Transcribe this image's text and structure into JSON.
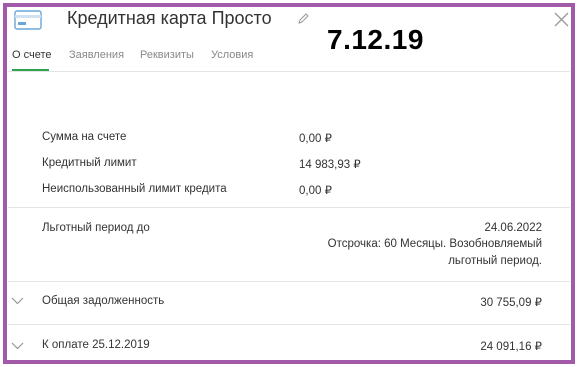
{
  "header": {
    "title": "Кредитная карта Просто",
    "date_stamp": "7.12.19",
    "card_icon": "credit-card-icon",
    "edit_icon": "pencil-icon",
    "close_icon": "close-icon"
  },
  "tabs": [
    {
      "label": "О счете",
      "active": true
    },
    {
      "label": "Заявления",
      "active": false
    },
    {
      "label": "Реквизиты",
      "active": false
    },
    {
      "label": "Условия",
      "active": false
    }
  ],
  "summary": [
    {
      "label": "Сумма на счете",
      "value": "0,00 ₽"
    },
    {
      "label": "Кредитный лимит",
      "value": "14 983,93 ₽"
    },
    {
      "label": "Неиспользованный лимит кредита",
      "value": "0,00 ₽"
    }
  ],
  "grace": {
    "label": "Льготный период до",
    "date": "24.06.2022",
    "note_line1": "Отсрочка: 60 Месяцы. Возобновляемый",
    "note_line2": "льготный период."
  },
  "debt": {
    "label": "Общая задолженность",
    "value": "30 755,09 ₽"
  },
  "payment": {
    "label": "К оплате 25.12.2019",
    "value": "24 091,16 ₽"
  },
  "colors": {
    "accent": "#2ea44f",
    "frame": "#a05aa8",
    "card_icon": "#6aa6d8"
  }
}
